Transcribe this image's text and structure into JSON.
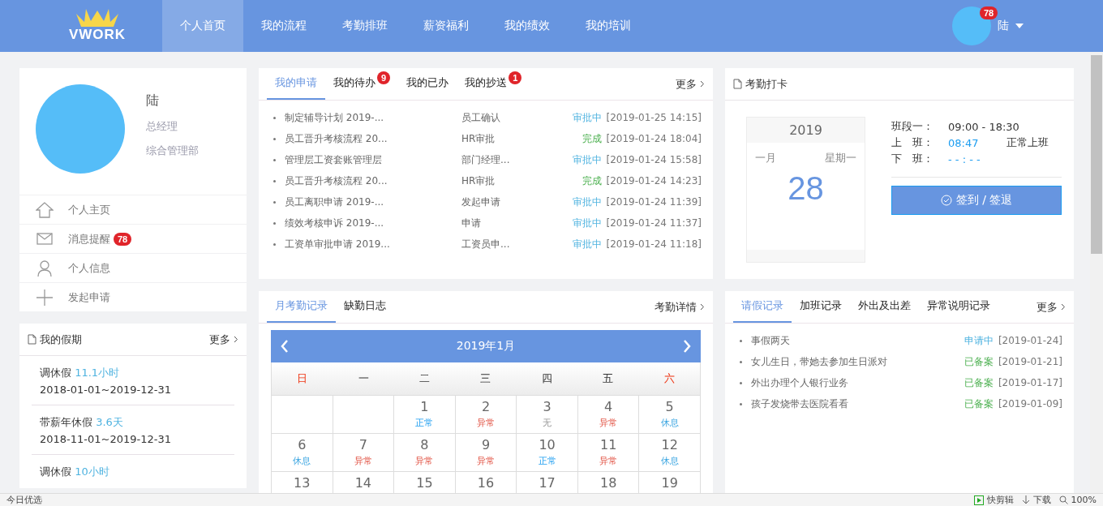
{
  "nav": {
    "logo": "VWORK",
    "items": [
      {
        "label": "个人首页",
        "selected": true
      },
      {
        "label": "我的流程",
        "selected": false
      },
      {
        "label": "考勤排班",
        "selected": false
      },
      {
        "label": "薪资福利",
        "selected": false
      },
      {
        "label": "我的绩效",
        "selected": false
      },
      {
        "label": "我的培训",
        "selected": false
      }
    ],
    "user": {
      "name": "陆",
      "badge": "78"
    }
  },
  "profile": {
    "name": "陆",
    "title": "总经理",
    "department": "综合管理部",
    "menu": [
      {
        "kind": "home",
        "label": "个人主页"
      },
      {
        "kind": "mail",
        "label": "消息提醒",
        "badge": "78"
      },
      {
        "kind": "user",
        "label": "个人信息"
      },
      {
        "kind": "plus",
        "label": "发起申请"
      }
    ]
  },
  "vacation": {
    "title": "我的假期",
    "more": "更多",
    "items": [
      {
        "type": "调休假",
        "amount": "11.1小时",
        "range": "2018-01-01~2019-12-31"
      },
      {
        "type": "带薪年休假",
        "amount": "3.6天",
        "range": "2018-11-01~2019-12-31"
      },
      {
        "type": "调休假",
        "amount": "10小时"
      }
    ]
  },
  "requests": {
    "more": "更多",
    "tabs": [
      {
        "label": "我的申请",
        "selected": true
      },
      {
        "label": "我的待办",
        "badge": "9",
        "selected": false
      },
      {
        "label": "我的已办",
        "selected": false
      },
      {
        "label": "我的抄送",
        "badge": "1",
        "selected": false
      }
    ],
    "rows": [
      {
        "title": "制定辅导计划 2019-...",
        "step": "员工确认",
        "status": "审批中",
        "kind": "pending",
        "time": "[2019-01-25 14:15]"
      },
      {
        "title": "员工晋升考核流程 20...",
        "step": "HR审批",
        "status": "完成",
        "kind": "done",
        "time": "[2019-01-24 18:04]"
      },
      {
        "title": "管理层工资套账管理层",
        "step": "部门经理...",
        "status": "审批中",
        "kind": "pending",
        "time": "[2019-01-24 15:58]"
      },
      {
        "title": "员工晋升考核流程 20...",
        "step": "HR审批",
        "status": "完成",
        "kind": "done",
        "time": "[2019-01-24 14:23]"
      },
      {
        "title": "员工离职申请 2019-...",
        "step": "发起申请",
        "status": "审批中",
        "kind": "pending",
        "time": "[2019-01-24 11:39]"
      },
      {
        "title": "绩效考核申诉 2019-...",
        "step": "申请",
        "status": "审批中",
        "kind": "pending",
        "time": "[2019-01-24 11:37]"
      },
      {
        "title": "工资单审批申请 2019...",
        "step": "工资员申...",
        "status": "审批中",
        "kind": "pending",
        "time": "[2019-01-24 11:18]"
      }
    ]
  },
  "clock_in": {
    "title": "考勤打卡",
    "year": "2019",
    "month": "一月",
    "weekday": "星期一",
    "day": "28",
    "shift": [
      {
        "label": "班段一：",
        "value": "09:00 - 18:30",
        "kind": "plain"
      },
      {
        "label": "上　班：",
        "value": "08:47",
        "kind": "time",
        "note": "正常上班"
      },
      {
        "label": "下　班：",
        "value": "- - : - -",
        "kind": "time"
      }
    ],
    "button": "签到 / 签退"
  },
  "attendance": {
    "link": "考勤详情",
    "tabs": [
      {
        "label": "月考勤记录",
        "selected": true
      },
      {
        "label": "缺勤日志",
        "selected": false
      }
    ],
    "month": "2019年1月",
    "weekdays": [
      {
        "label": "日",
        "weekend": true
      },
      {
        "label": "一",
        "weekend": false
      },
      {
        "label": "二",
        "weekend": false
      },
      {
        "label": "三",
        "weekend": false
      },
      {
        "label": "四",
        "weekend": false
      },
      {
        "label": "五",
        "weekend": false
      },
      {
        "label": "六",
        "weekend": true
      }
    ],
    "weeks": [
      [
        {
          "kind": "blank"
        },
        {
          "kind": "blank"
        },
        {
          "day": "1",
          "status": "正常",
          "kind": "normal"
        },
        {
          "day": "2",
          "status": "异常",
          "kind": "abnormal"
        },
        {
          "day": "3",
          "status": "无",
          "kind": "none"
        },
        {
          "day": "4",
          "status": "异常",
          "kind": "abnormal"
        },
        {
          "day": "5",
          "status": "休息",
          "kind": "rest"
        }
      ],
      [
        {
          "day": "6",
          "status": "休息",
          "kind": "rest"
        },
        {
          "day": "7",
          "status": "异常",
          "kind": "abnormal"
        },
        {
          "day": "8",
          "status": "异常",
          "kind": "abnormal"
        },
        {
          "day": "9",
          "status": "异常",
          "kind": "abnormal"
        },
        {
          "day": "10",
          "status": "正常",
          "kind": "normal"
        },
        {
          "day": "11",
          "status": "异常",
          "kind": "abnormal"
        },
        {
          "day": "12",
          "status": "休息",
          "kind": "rest"
        }
      ],
      [
        {
          "day": "13"
        },
        {
          "day": "14"
        },
        {
          "day": "15"
        },
        {
          "day": "16"
        },
        {
          "day": "17"
        },
        {
          "day": "18"
        },
        {
          "day": "19"
        }
      ]
    ]
  },
  "records": {
    "more": "更多",
    "tabs": [
      {
        "label": "请假记录",
        "selected": true
      },
      {
        "label": "加班记录",
        "selected": false
      },
      {
        "label": "外出及出差",
        "selected": false
      },
      {
        "label": "异常说明记录",
        "selected": false
      }
    ],
    "rows": [
      {
        "title": "事假两天",
        "status": "申请中",
        "kind": "pending",
        "date": "[2019-01-24]"
      },
      {
        "title": "女儿生日，带她去参加生日派对",
        "status": "已备案",
        "kind": "done",
        "date": "[2019-01-21]"
      },
      {
        "title": "外出办理个人银行业务",
        "status": "已备案",
        "kind": "done",
        "date": "[2019-01-17]"
      },
      {
        "title": "孩子发烧带去医院看看",
        "status": "已备案",
        "kind": "done",
        "date": "[2019-01-09]"
      }
    ]
  },
  "status_bar": {
    "left": "今日优选",
    "items": [
      {
        "kind": "video",
        "label": "快剪辑"
      },
      {
        "kind": "download",
        "label": "下载"
      },
      {
        "kind": "zoom",
        "label": "100%"
      }
    ]
  }
}
